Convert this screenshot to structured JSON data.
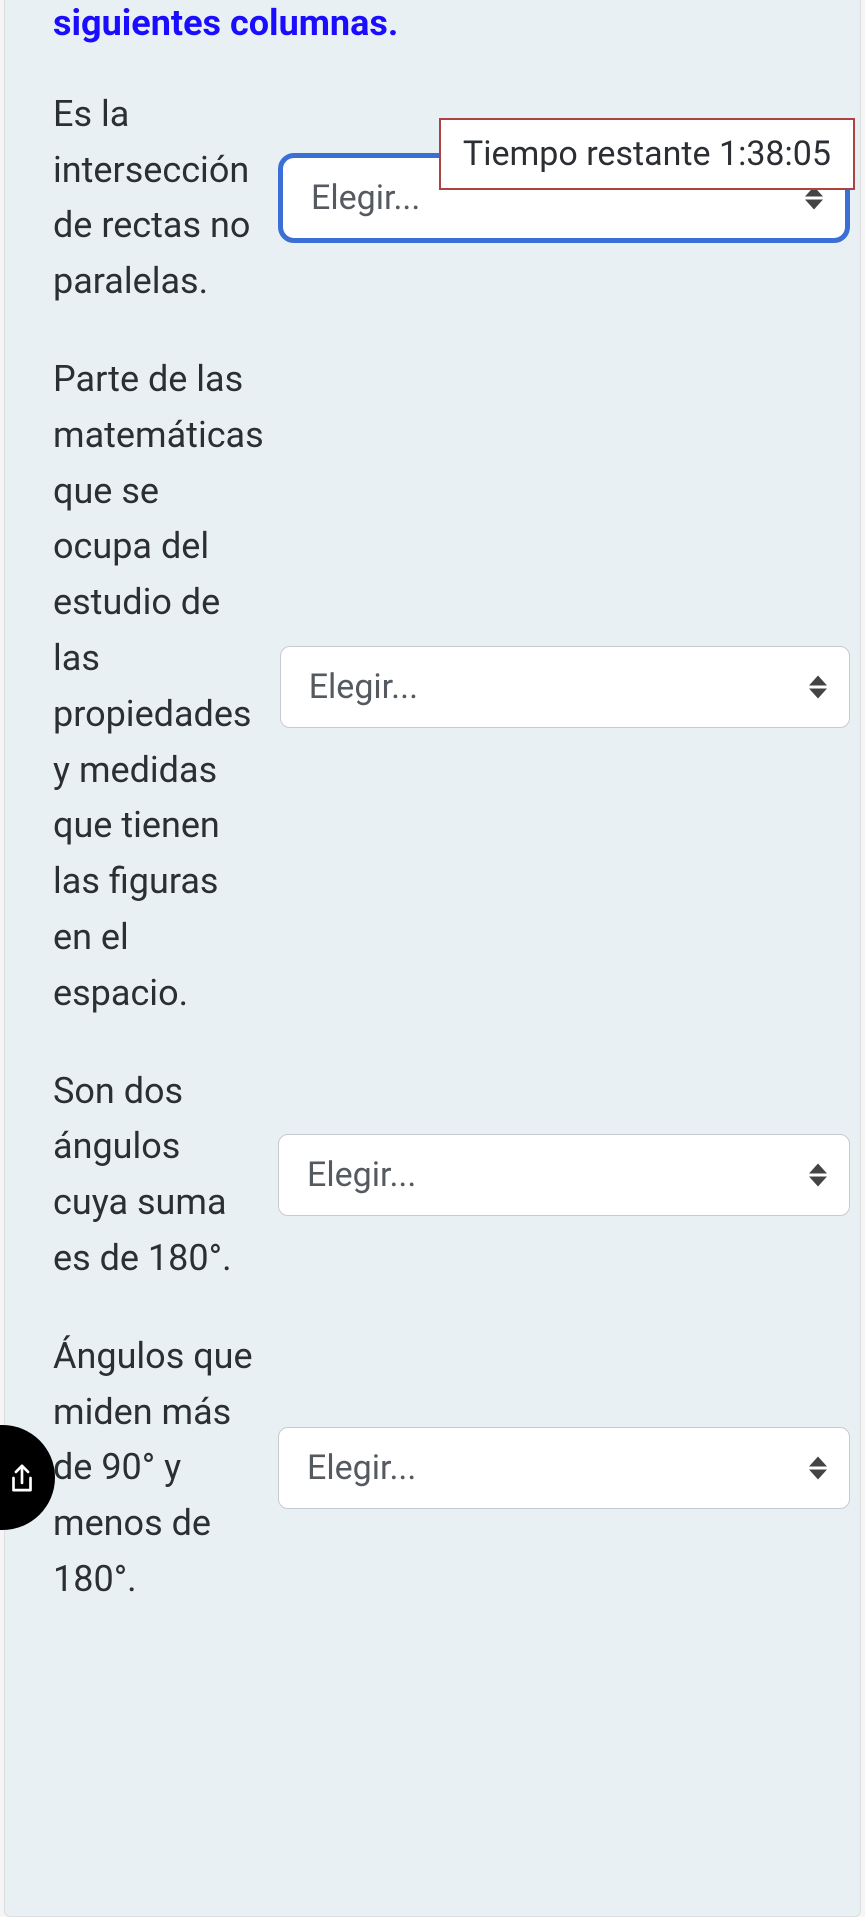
{
  "instruction_tail": "siguientes columnas.",
  "timer_text": "Tiempo restante 1:38:05",
  "select_placeholder": "Elegir...",
  "questions": [
    {
      "prompt": "Es la intersección de rectas no paralelas."
    },
    {
      "prompt": "Parte de las matemáticas que se ocupa del estudio de las propiedades y medidas que tienen las figuras en el espacio."
    },
    {
      "prompt": "Son dos ángulos cuya suma es de 180°."
    },
    {
      "prompt": "Ángulos que miden más de 90° y menos de 180°."
    }
  ]
}
